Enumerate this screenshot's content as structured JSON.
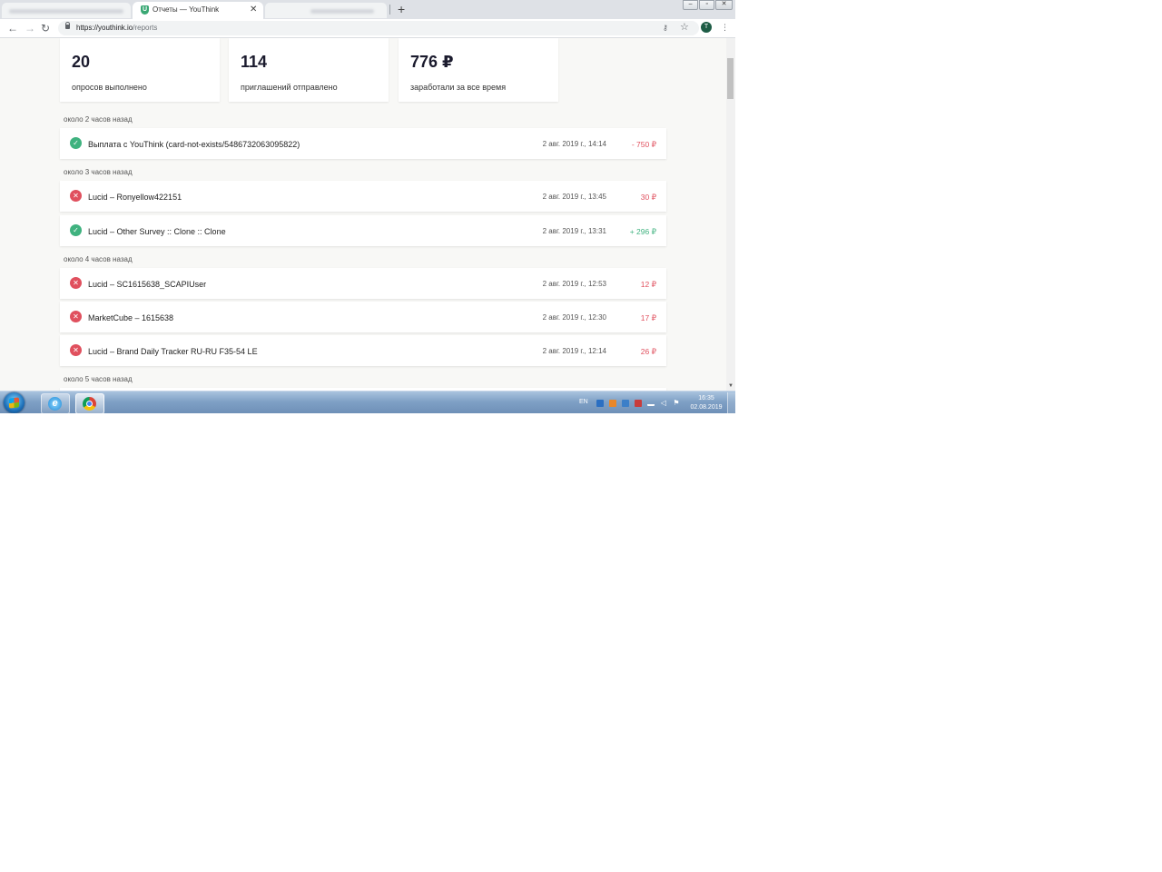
{
  "browser": {
    "tab_title": "Отчеты — YouThink",
    "favicon_letter": "U",
    "url_host": "https://youthink.io",
    "url_path": "/reports",
    "avatar_letter": "T",
    "close_glyph": "✕",
    "new_tab_glyph": "+",
    "back_glyph": "←",
    "forward_glyph": "→",
    "reload_glyph": "↻",
    "key_glyph": "⚷",
    "star_glyph": "☆",
    "menu_glyph": "⋮",
    "win_min_glyph": "–",
    "win_max_glyph": "▫",
    "win_close_glyph": "✕"
  },
  "stats": [
    {
      "value": "20",
      "label": "опросов выполнено"
    },
    {
      "value": "114",
      "label": "приглашений отправлено"
    },
    {
      "value": "776 ₽",
      "label": "заработали за все время"
    }
  ],
  "groups": [
    {
      "label": "около 2 часов назад",
      "rows": [
        {
          "status": "ok",
          "title": "Выплата с YouThink (card-not-exists/5486732063095822)",
          "date": "2 авг. 2019 г., 14:14",
          "amount": "- 750 ₽",
          "amount_kind": "neg"
        }
      ]
    },
    {
      "label": "около 3 часов назад",
      "rows": [
        {
          "status": "fail",
          "title": "Lucid – Ronyellow422151",
          "date": "2 авг. 2019 г., 13:45",
          "amount": "30 ₽",
          "amount_kind": "neg"
        },
        {
          "status": "ok",
          "title": "Lucid – Other Survey :: Clone :: Clone",
          "date": "2 авг. 2019 г., 13:31",
          "amount": "+ 296 ₽",
          "amount_kind": "pos"
        }
      ]
    },
    {
      "label": "около 4 часов назад",
      "rows": [
        {
          "status": "fail",
          "title": "Lucid – SC1615638_SCAPIUser",
          "date": "2 авг. 2019 г., 12:53",
          "amount": "12 ₽",
          "amount_kind": "neg"
        },
        {
          "status": "fail",
          "title": "MarketCube – 1615638",
          "date": "2 авг. 2019 г., 12:30",
          "amount": "17 ₽",
          "amount_kind": "neg"
        },
        {
          "status": "fail",
          "title": "Lucid – Brand Daily Tracker RU-RU F35-54 LE",
          "date": "2 авг. 2019 г., 12:14",
          "amount": "26 ₽",
          "amount_kind": "neg"
        }
      ]
    },
    {
      "label": "около 5 часов назад",
      "rows": []
    }
  ],
  "status_glyphs": {
    "ok": "✓",
    "fail": "✕"
  },
  "colors": {
    "ok": "#3fb27f",
    "fail": "#e0505e",
    "page_bg": "#f8f8f6"
  },
  "taskbar": {
    "lang": "EN",
    "time": "16:35",
    "date": "02.08.2019",
    "ie_glyph": "e"
  }
}
